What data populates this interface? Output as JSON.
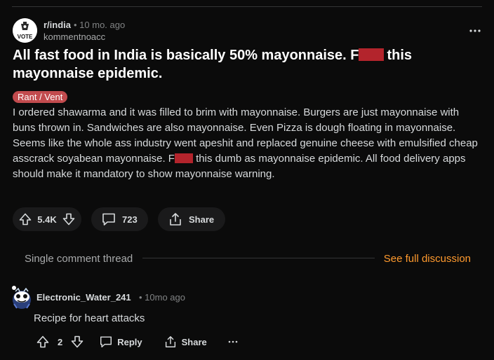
{
  "post": {
    "subreddit": "r/india",
    "time": "• 10 mo. ago",
    "author": "kommentnoacc",
    "avatar_text": "VOTE",
    "title_part1": "All fast food in India is basically 50% mayonnaise. F",
    "title_part2": "this mayonnaise epidemic.",
    "flair": "Rant / Vent",
    "body_part1": "I ordered shawarma and it was filled to brim with mayonnaise. Burgers are just mayonnaise with buns thrown in. Sandwiches are also mayonnaise. Even Pizza is dough floating in mayonnaise. Seems like the whole ass industry went apeshit and replaced genuine cheese with emulsified cheap asscrack soyabean mayonnaise. F",
    "body_part2": "this dumb as mayonnaise epidemic. All food delivery apps should make it mandatory to show mayonnaise warning.",
    "votes": "5.4K",
    "comments": "723",
    "share_label": "Share"
  },
  "thread": {
    "label": "Single comment thread",
    "see_full": "See full discussion"
  },
  "comment": {
    "user": "Electronic_Water_241",
    "time": "• 10mo ago",
    "text": "Recipe for heart attacks",
    "votes": "2",
    "reply_label": "Reply",
    "share_label": "Share"
  },
  "colors": {
    "background": "#0b0b0b",
    "redaction": "#b3242c",
    "flair": "#c24b4e",
    "accent_link": "#ff9a2e"
  }
}
